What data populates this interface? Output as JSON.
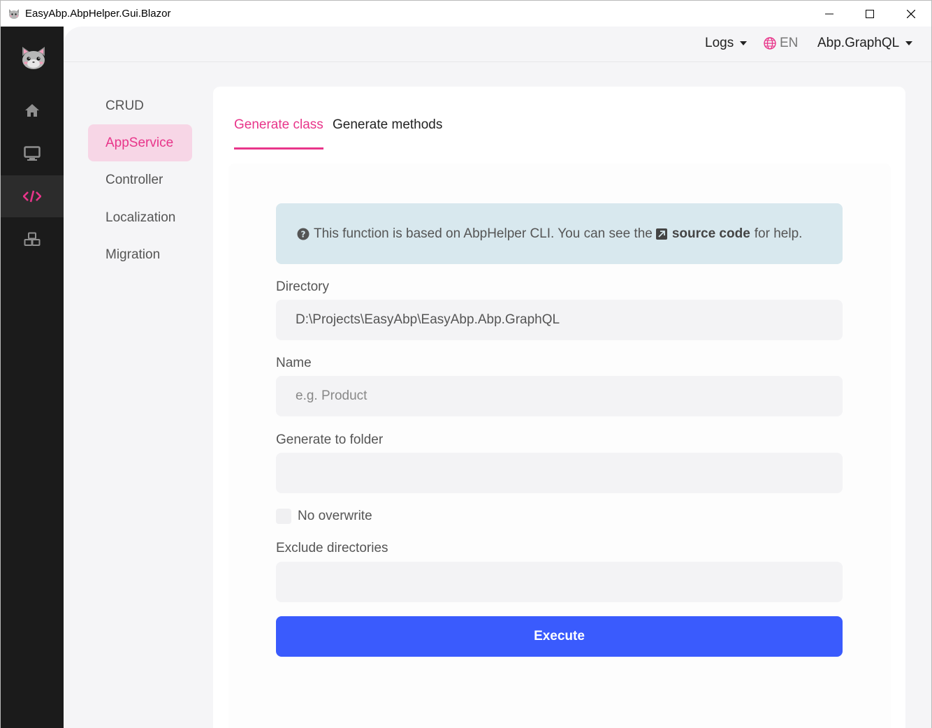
{
  "window": {
    "title": "EasyAbp.AbpHelper.Gui.Blazor",
    "minimize_icon": "minimize-icon",
    "maximize_icon": "maximize-icon",
    "close_icon": "close-icon"
  },
  "rail": {
    "logo": "cat-logo",
    "items": [
      {
        "icon": "home-icon",
        "active": false
      },
      {
        "icon": "monitor-icon",
        "active": false
      },
      {
        "icon": "code-icon",
        "active": true
      },
      {
        "icon": "cubes-icon",
        "active": false
      }
    ]
  },
  "topbar": {
    "logs_label": "Logs",
    "language_label": "EN",
    "project_label": "Abp.GraphQL"
  },
  "subnav": {
    "items": [
      {
        "label": "CRUD",
        "active": false
      },
      {
        "label": "AppService",
        "active": true
      },
      {
        "label": "Controller",
        "active": false
      },
      {
        "label": "Localization",
        "active": false
      },
      {
        "label": "Migration",
        "active": false
      }
    ]
  },
  "tabs": {
    "generate_class": "Generate class",
    "generate_methods": "Generate methods"
  },
  "alert": {
    "text_before": "This function is based on AbpHelper CLI. You can see the",
    "link_text": "source code",
    "text_after": "for help."
  },
  "form": {
    "directory_label": "Directory",
    "directory_value": "D:\\Projects\\EasyAbp\\EasyAbp.Abp.GraphQL",
    "name_label": "Name",
    "name_placeholder": "e.g. Product",
    "folder_label": "Generate to folder",
    "folder_value": "",
    "no_overwrite_label": "No overwrite",
    "no_overwrite_checked": false,
    "exclude_label": "Exclude directories",
    "exclude_value": "",
    "execute_label": "Execute"
  },
  "colors": {
    "accent": "#e8358a",
    "primary_button": "#3a5bfd",
    "rail_background": "#1b1b1b",
    "alert_background": "#d8e8ee"
  }
}
